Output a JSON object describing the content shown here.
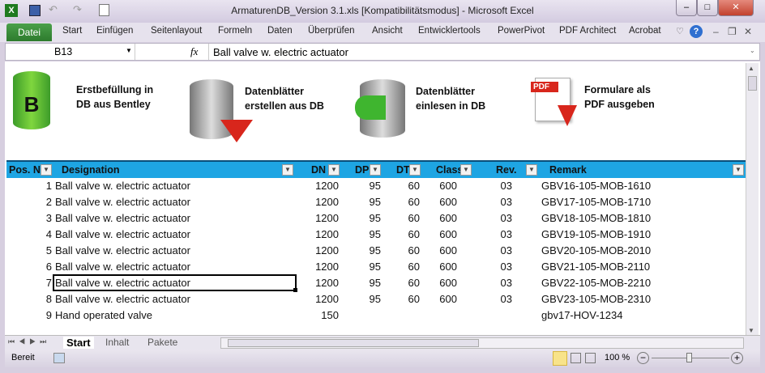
{
  "window": {
    "title": "ArmaturenDB_Version 3.1.xls  [Kompatibilitätsmodus]  -  Microsoft Excel"
  },
  "ribbon": {
    "file_tab": "Datei",
    "tabs": [
      "Start",
      "Einfügen",
      "Seitenlayout",
      "Formeln",
      "Daten",
      "Überprüfen",
      "Ansicht",
      "Entwicklertools",
      "PowerPivot",
      "PDF Architect",
      "Acrobat"
    ]
  },
  "formula_bar": {
    "name_box": "B13",
    "fx": "fx",
    "value": "Ball valve w. electric actuator"
  },
  "actions": [
    {
      "label1": "Erstbefüllung in",
      "label2": "DB aus Bentley",
      "icon": "database-b-icon"
    },
    {
      "label1": "Datenblätter",
      "label2": "erstellen aus DB",
      "icon": "database-export-icon"
    },
    {
      "label1": "Datenblätter",
      "label2": "einlesen in DB",
      "icon": "database-import-icon"
    },
    {
      "label1": "Formulare als",
      "label2": "PDF ausgeben",
      "icon": "pdf-icon"
    }
  ],
  "table": {
    "headers": [
      "Pos. N",
      "Designation",
      "DN",
      "DP",
      "DT",
      "Class",
      "Rev.",
      "Remark"
    ],
    "rows": [
      [
        "1",
        "Ball valve w. electric actuator",
        "1200",
        "95",
        "60",
        "600",
        "03",
        "GBV16-105-MOB-1610"
      ],
      [
        "2",
        "Ball valve w. electric actuator",
        "1200",
        "95",
        "60",
        "600",
        "03",
        "GBV17-105-MOB-1710"
      ],
      [
        "3",
        "Ball valve w. electric actuator",
        "1200",
        "95",
        "60",
        "600",
        "03",
        "GBV18-105-MOB-1810"
      ],
      [
        "4",
        "Ball valve w. electric actuator",
        "1200",
        "95",
        "60",
        "600",
        "03",
        "GBV19-105-MOB-1910"
      ],
      [
        "5",
        "Ball valve w. electric actuator",
        "1200",
        "95",
        "60",
        "600",
        "03",
        "GBV20-105-MOB-2010"
      ],
      [
        "6",
        "Ball valve w. electric actuator",
        "1200",
        "95",
        "60",
        "600",
        "03",
        "GBV21-105-MOB-2110"
      ],
      [
        "7",
        "Ball valve w. electric actuator",
        "1200",
        "95",
        "60",
        "600",
        "03",
        "GBV22-105-MOB-2210"
      ],
      [
        "8",
        "Ball valve w. electric actuator",
        "1200",
        "95",
        "60",
        "600",
        "03",
        "GBV23-105-MOB-2310"
      ],
      [
        "9",
        "Hand operated valve",
        "150",
        "",
        "",
        "",
        "",
        "gbv17-HOV-1234"
      ]
    ]
  },
  "sheets": [
    "Start",
    "Inhalt",
    "Pakete"
  ],
  "status": {
    "ready": "Bereit",
    "zoom": "100 %"
  }
}
